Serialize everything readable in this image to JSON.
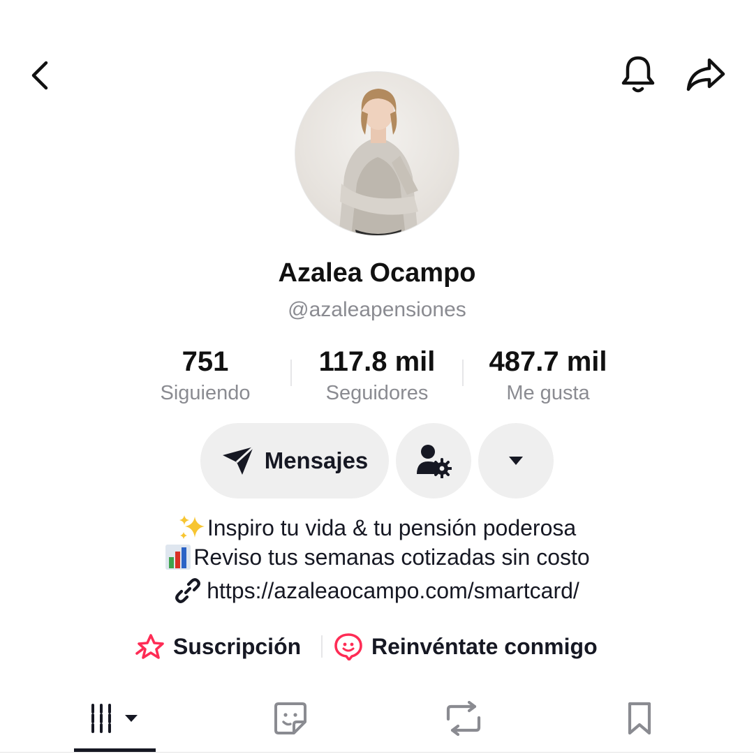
{
  "profile": {
    "display_name": "Azalea Ocampo",
    "username": "@azaleapensiones"
  },
  "stats": {
    "following": {
      "value": "751",
      "label": "Siguiendo"
    },
    "followers": {
      "value": "117.8 mil",
      "label": "Seguidores"
    },
    "likes": {
      "value": "487.7 mil",
      "label": "Me gusta"
    }
  },
  "actions": {
    "message_label": "Mensajes"
  },
  "bio": {
    "line1_emoji": "sparkles",
    "line1": "Inspiro tu vida & tu pensión poderosa",
    "line2_emoji": "bar-chart",
    "line2": "Reviso tus semanas cotizadas sin costo",
    "link": "https://azaleaocampo.com/smartcard/"
  },
  "features": {
    "subscription_label": "Suscripción",
    "reinvent_label": "Reinvéntate conmigo"
  },
  "icons": {
    "back": "chevron-left-icon",
    "notifications": "bell-icon",
    "share": "share-arrow-icon",
    "send": "paper-plane-icon",
    "user_settings": "user-gear-icon",
    "more": "caret-down-icon",
    "link": "link-icon",
    "tab_videos": "grid-icon",
    "tab_stickers": "sticker-icon",
    "tab_reposts": "repost-icon",
    "tab_saved": "bookmark-icon"
  },
  "colors": {
    "primary_text": "#161823",
    "secondary_text": "#8a8b91",
    "button_bg": "#efefef",
    "accent_pink": "#fe2c55"
  }
}
